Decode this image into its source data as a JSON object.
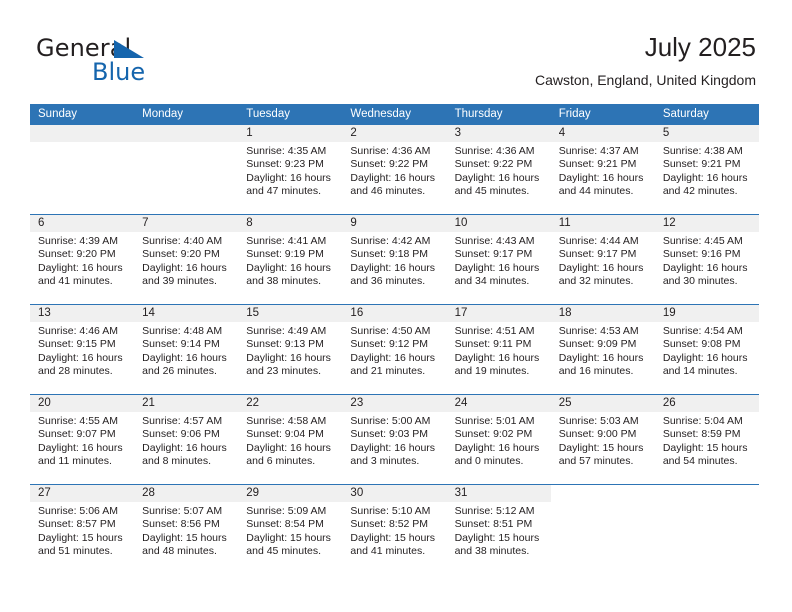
{
  "logo": {
    "word_one": "General",
    "word_two": "Blue",
    "triangle_icon": "triangle-icon",
    "accent_color": "#1565ad"
  },
  "header": {
    "title": "July 2025",
    "subtitle": "Cawston, England, United Kingdom"
  },
  "theme": {
    "header_blue": "#2d74b5",
    "daynum_band": "#f0f0f0",
    "text": "#231f20"
  },
  "calendar": {
    "weekday_headers": [
      "Sunday",
      "Monday",
      "Tuesday",
      "Wednesday",
      "Thursday",
      "Friday",
      "Saturday"
    ],
    "weeks": [
      [
        {
          "day": "",
          "blank": true
        },
        {
          "day": "",
          "blank": true
        },
        {
          "day": "1",
          "sunrise": "Sunrise: 4:35 AM",
          "sunset": "Sunset: 9:23 PM",
          "daylight_1": "Daylight: 16 hours",
          "daylight_2": "and 47 minutes."
        },
        {
          "day": "2",
          "sunrise": "Sunrise: 4:36 AM",
          "sunset": "Sunset: 9:22 PM",
          "daylight_1": "Daylight: 16 hours",
          "daylight_2": "and 46 minutes."
        },
        {
          "day": "3",
          "sunrise": "Sunrise: 4:36 AM",
          "sunset": "Sunset: 9:22 PM",
          "daylight_1": "Daylight: 16 hours",
          "daylight_2": "and 45 minutes."
        },
        {
          "day": "4",
          "sunrise": "Sunrise: 4:37 AM",
          "sunset": "Sunset: 9:21 PM",
          "daylight_1": "Daylight: 16 hours",
          "daylight_2": "and 44 minutes."
        },
        {
          "day": "5",
          "sunrise": "Sunrise: 4:38 AM",
          "sunset": "Sunset: 9:21 PM",
          "daylight_1": "Daylight: 16 hours",
          "daylight_2": "and 42 minutes."
        }
      ],
      [
        {
          "day": "6",
          "sunrise": "Sunrise: 4:39 AM",
          "sunset": "Sunset: 9:20 PM",
          "daylight_1": "Daylight: 16 hours",
          "daylight_2": "and 41 minutes."
        },
        {
          "day": "7",
          "sunrise": "Sunrise: 4:40 AM",
          "sunset": "Sunset: 9:20 PM",
          "daylight_1": "Daylight: 16 hours",
          "daylight_2": "and 39 minutes."
        },
        {
          "day": "8",
          "sunrise": "Sunrise: 4:41 AM",
          "sunset": "Sunset: 9:19 PM",
          "daylight_1": "Daylight: 16 hours",
          "daylight_2": "and 38 minutes."
        },
        {
          "day": "9",
          "sunrise": "Sunrise: 4:42 AM",
          "sunset": "Sunset: 9:18 PM",
          "daylight_1": "Daylight: 16 hours",
          "daylight_2": "and 36 minutes."
        },
        {
          "day": "10",
          "sunrise": "Sunrise: 4:43 AM",
          "sunset": "Sunset: 9:17 PM",
          "daylight_1": "Daylight: 16 hours",
          "daylight_2": "and 34 minutes."
        },
        {
          "day": "11",
          "sunrise": "Sunrise: 4:44 AM",
          "sunset": "Sunset: 9:17 PM",
          "daylight_1": "Daylight: 16 hours",
          "daylight_2": "and 32 minutes."
        },
        {
          "day": "12",
          "sunrise": "Sunrise: 4:45 AM",
          "sunset": "Sunset: 9:16 PM",
          "daylight_1": "Daylight: 16 hours",
          "daylight_2": "and 30 minutes."
        }
      ],
      [
        {
          "day": "13",
          "sunrise": "Sunrise: 4:46 AM",
          "sunset": "Sunset: 9:15 PM",
          "daylight_1": "Daylight: 16 hours",
          "daylight_2": "and 28 minutes."
        },
        {
          "day": "14",
          "sunrise": "Sunrise: 4:48 AM",
          "sunset": "Sunset: 9:14 PM",
          "daylight_1": "Daylight: 16 hours",
          "daylight_2": "and 26 minutes."
        },
        {
          "day": "15",
          "sunrise": "Sunrise: 4:49 AM",
          "sunset": "Sunset: 9:13 PM",
          "daylight_1": "Daylight: 16 hours",
          "daylight_2": "and 23 minutes."
        },
        {
          "day": "16",
          "sunrise": "Sunrise: 4:50 AM",
          "sunset": "Sunset: 9:12 PM",
          "daylight_1": "Daylight: 16 hours",
          "daylight_2": "and 21 minutes."
        },
        {
          "day": "17",
          "sunrise": "Sunrise: 4:51 AM",
          "sunset": "Sunset: 9:11 PM",
          "daylight_1": "Daylight: 16 hours",
          "daylight_2": "and 19 minutes."
        },
        {
          "day": "18",
          "sunrise": "Sunrise: 4:53 AM",
          "sunset": "Sunset: 9:09 PM",
          "daylight_1": "Daylight: 16 hours",
          "daylight_2": "and 16 minutes."
        },
        {
          "day": "19",
          "sunrise": "Sunrise: 4:54 AM",
          "sunset": "Sunset: 9:08 PM",
          "daylight_1": "Daylight: 16 hours",
          "daylight_2": "and 14 minutes."
        }
      ],
      [
        {
          "day": "20",
          "sunrise": "Sunrise: 4:55 AM",
          "sunset": "Sunset: 9:07 PM",
          "daylight_1": "Daylight: 16 hours",
          "daylight_2": "and 11 minutes."
        },
        {
          "day": "21",
          "sunrise": "Sunrise: 4:57 AM",
          "sunset": "Sunset: 9:06 PM",
          "daylight_1": "Daylight: 16 hours",
          "daylight_2": "and 8 minutes."
        },
        {
          "day": "22",
          "sunrise": "Sunrise: 4:58 AM",
          "sunset": "Sunset: 9:04 PM",
          "daylight_1": "Daylight: 16 hours",
          "daylight_2": "and 6 minutes."
        },
        {
          "day": "23",
          "sunrise": "Sunrise: 5:00 AM",
          "sunset": "Sunset: 9:03 PM",
          "daylight_1": "Daylight: 16 hours",
          "daylight_2": "and 3 minutes."
        },
        {
          "day": "24",
          "sunrise": "Sunrise: 5:01 AM",
          "sunset": "Sunset: 9:02 PM",
          "daylight_1": "Daylight: 16 hours",
          "daylight_2": "and 0 minutes."
        },
        {
          "day": "25",
          "sunrise": "Sunrise: 5:03 AM",
          "sunset": "Sunset: 9:00 PM",
          "daylight_1": "Daylight: 15 hours",
          "daylight_2": "and 57 minutes."
        },
        {
          "day": "26",
          "sunrise": "Sunrise: 5:04 AM",
          "sunset": "Sunset: 8:59 PM",
          "daylight_1": "Daylight: 15 hours",
          "daylight_2": "and 54 minutes."
        }
      ],
      [
        {
          "day": "27",
          "sunrise": "Sunrise: 5:06 AM",
          "sunset": "Sunset: 8:57 PM",
          "daylight_1": "Daylight: 15 hours",
          "daylight_2": "and 51 minutes."
        },
        {
          "day": "28",
          "sunrise": "Sunrise: 5:07 AM",
          "sunset": "Sunset: 8:56 PM",
          "daylight_1": "Daylight: 15 hours",
          "daylight_2": "and 48 minutes."
        },
        {
          "day": "29",
          "sunrise": "Sunrise: 5:09 AM",
          "sunset": "Sunset: 8:54 PM",
          "daylight_1": "Daylight: 15 hours",
          "daylight_2": "and 45 minutes."
        },
        {
          "day": "30",
          "sunrise": "Sunrise: 5:10 AM",
          "sunset": "Sunset: 8:52 PM",
          "daylight_1": "Daylight: 15 hours",
          "daylight_2": "and 41 minutes."
        },
        {
          "day": "31",
          "sunrise": "Sunrise: 5:12 AM",
          "sunset": "Sunset: 8:51 PM",
          "daylight_1": "Daylight: 15 hours",
          "daylight_2": "and 38 minutes."
        },
        {
          "day": "",
          "trailing": true
        },
        {
          "day": "",
          "trailing": true
        }
      ]
    ]
  }
}
